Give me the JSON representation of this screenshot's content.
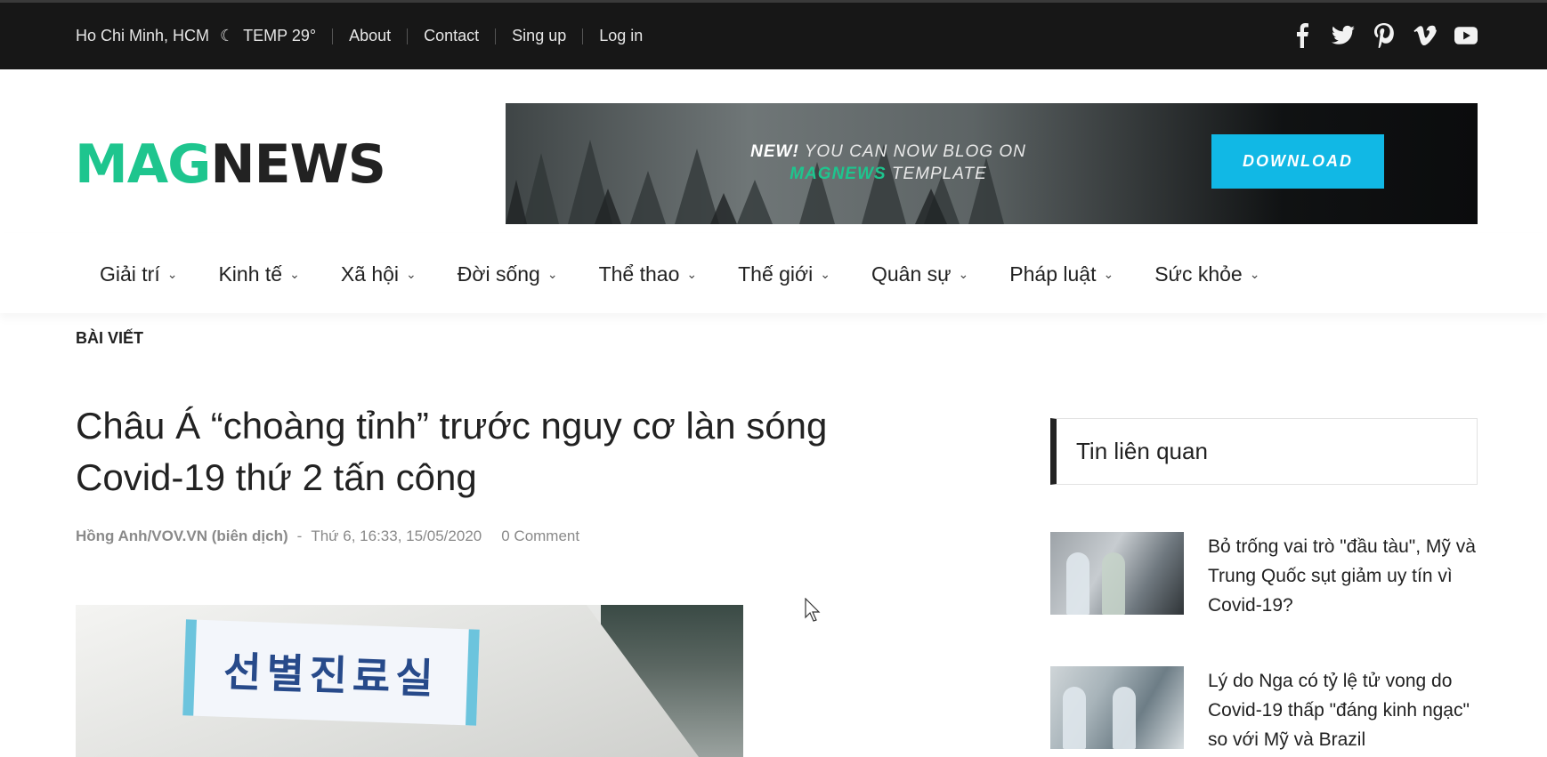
{
  "topbar": {
    "location": "Ho Chi Minh, HCM",
    "temp": "TEMP 29°",
    "links": [
      "About",
      "Contact",
      "Sing up",
      "Log in"
    ]
  },
  "social_icons": [
    "facebook-icon",
    "twitter-icon",
    "pinterest-icon",
    "vimeo-icon",
    "youtube-icon"
  ],
  "logo": {
    "part1": "MAG",
    "part2": "NEWS"
  },
  "banner": {
    "new": "NEW!",
    "line1": " YOU CAN NOW BLOG ON",
    "brand": "MAGNEWS",
    "line2": " TEMPLATE",
    "button": "DOWNLOAD"
  },
  "nav": [
    "Giải trí",
    "Kinh tế",
    "Xã hội",
    "Đời sống",
    "Thể thao",
    "Thế giới",
    "Quân sự",
    "Pháp luật",
    "Sức khỏe"
  ],
  "breadcrumb": "BÀI VIẾT",
  "article": {
    "title": "Châu Á “choàng tỉnh” trước nguy cơ làn sóng Covid-19 thứ 2 tấn công",
    "author": "Hồng Anh/VOV.VN (biên dịch)",
    "sep": "-",
    "date": "Thứ 6, 16:33, 15/05/2020",
    "comments": "0 Comment",
    "sign_text": "선별진료실"
  },
  "sidebar": {
    "heading": "Tin liên quan",
    "items": [
      {
        "title": "Bỏ trống vai trò \"đầu tàu\", Mỹ và Trung Quốc sụt giảm uy tín vì Covid-19?"
      },
      {
        "title": "Lý do Nga có tỷ lệ tử vong do Covid-19 thấp \"đáng kinh ngạc\" so với Mỹ và Brazil"
      }
    ]
  },
  "colors": {
    "accent": "#1ec58e",
    "download": "#11b8e5",
    "topbar": "#171717"
  }
}
